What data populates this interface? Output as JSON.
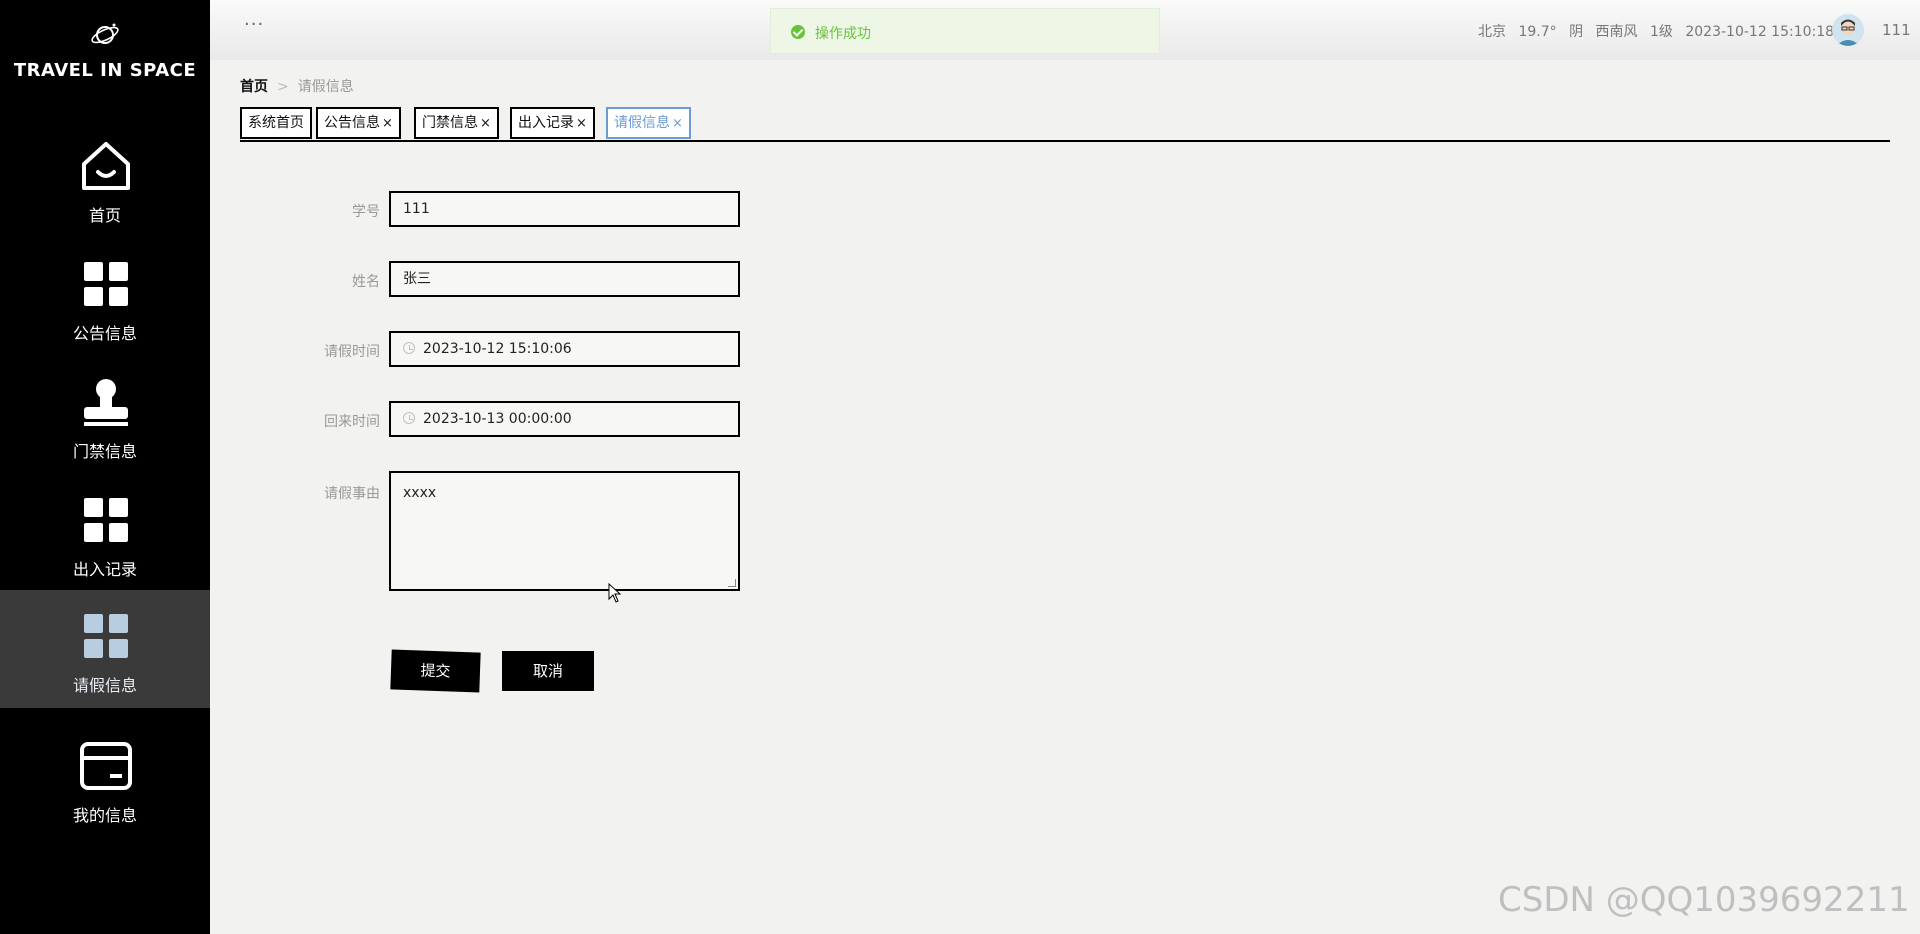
{
  "brand": {
    "title": "TRAVEL IN SPACE"
  },
  "sidebar": {
    "items": [
      {
        "label": "首页",
        "icon": "home-icon"
      },
      {
        "label": "公告信息",
        "icon": "grid-icon"
      },
      {
        "label": "门禁信息",
        "icon": "stamp-icon"
      },
      {
        "label": "出入记录",
        "icon": "grid-icon"
      },
      {
        "label": "请假信息",
        "icon": "grid-icon",
        "active": true
      },
      {
        "label": "我的信息",
        "icon": "card-icon"
      }
    ]
  },
  "topbar": {
    "menu_dots": "···",
    "toast": "操作成功",
    "weather": {
      "city": "北京",
      "temp": "19.7°",
      "condition": "阴",
      "wind": "西南风",
      "level": "1级",
      "datetime": "2023-10-12 15:10:18"
    },
    "username": "111"
  },
  "breadcrumb": {
    "home": "首页",
    "separator": ">",
    "current": "请假信息"
  },
  "tabs": [
    {
      "label": "系统首页",
      "closable": false
    },
    {
      "label": "公告信息",
      "closable": true
    },
    {
      "label": "门禁信息",
      "closable": true
    },
    {
      "label": "出入记录",
      "closable": true
    },
    {
      "label": "请假信息",
      "closable": true,
      "active": true
    }
  ],
  "tab_close": "×",
  "form": {
    "student_id": {
      "label": "学号",
      "value": "111"
    },
    "name": {
      "label": "姓名",
      "value": "张三"
    },
    "leave_time": {
      "label": "请假时间",
      "value": "2023-10-12 15:10:06"
    },
    "return_time": {
      "label": "回来时间",
      "value": "2023-10-13 00:00:00"
    },
    "reason": {
      "label": "请假事由",
      "value": "xxxx"
    },
    "submit_label": "提交",
    "cancel_label": "取消"
  },
  "watermark": "CSDN @QQ1039692211",
  "colors": {
    "sidebar_bg": "#000000",
    "active_tab": "#6b9bd1",
    "toast_green": "#67c23a"
  }
}
